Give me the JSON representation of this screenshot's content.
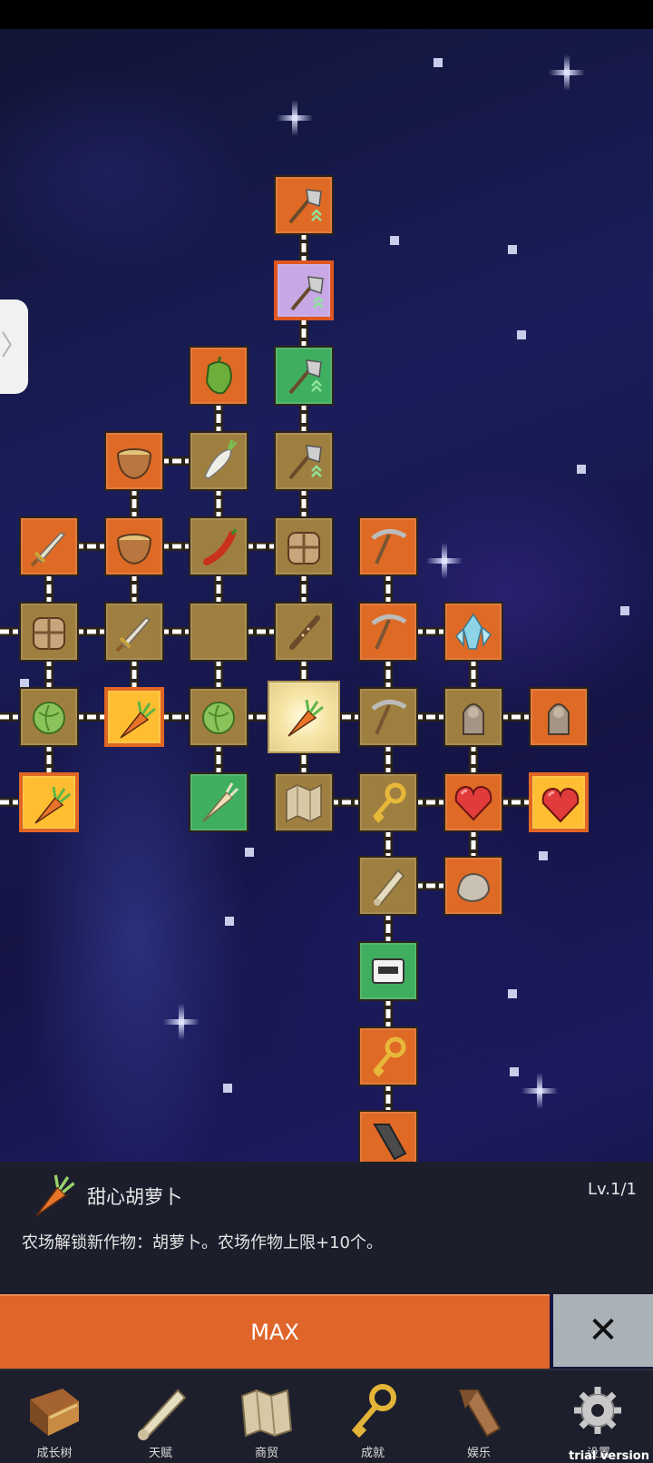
{
  "side_handle": {
    "glyph": "〉"
  },
  "info": {
    "icon": "carrot-icon",
    "name": "甜心胡萝卜",
    "level": "Lv.1/1",
    "description": "农场解锁新作物：胡萝卜。农场作物上限+10个。"
  },
  "actions": {
    "max_label": "MAX",
    "close_label": "✕"
  },
  "nav": [
    {
      "label": "成长树",
      "icon": "book-icon"
    },
    {
      "label": "天赋",
      "icon": "scroll-icon"
    },
    {
      "label": "商贸",
      "icon": "map-icon"
    },
    {
      "label": "成就",
      "icon": "key-icon"
    },
    {
      "label": "娱乐",
      "icon": "horn-icon"
    },
    {
      "label": "设置",
      "icon": "gear-icon"
    }
  ],
  "watermark": "trial version",
  "tree_nodes": [
    {
      "id": "n1",
      "icon": "shovel-upgrade-icon",
      "color": "orange"
    },
    {
      "id": "n2",
      "icon": "shovel-upgrade-icon",
      "color": "purple"
    },
    {
      "id": "n3",
      "icon": "pepper-icon",
      "color": "orange"
    },
    {
      "id": "n4",
      "icon": "shovel-upgrade-icon",
      "color": "green"
    },
    {
      "id": "n5",
      "icon": "bowl-icon",
      "color": "orange"
    },
    {
      "id": "n6",
      "icon": "radish-icon",
      "color": "brown"
    },
    {
      "id": "n7",
      "icon": "shovel-upgrade-icon",
      "color": "brown"
    },
    {
      "id": "n8",
      "icon": "sword-icon",
      "color": "orange"
    },
    {
      "id": "n9",
      "icon": "bowl-icon",
      "color": "orange"
    },
    {
      "id": "n10",
      "icon": "chili-icon",
      "color": "brown"
    },
    {
      "id": "n11",
      "icon": "backpack-icon",
      "color": "brown"
    },
    {
      "id": "n12",
      "icon": "pickaxe-icon",
      "color": "orange"
    },
    {
      "id": "n13",
      "icon": "backpack-icon",
      "color": "brown"
    },
    {
      "id": "n14",
      "icon": "sword-icon",
      "color": "brown"
    },
    {
      "id": "n15",
      "icon": "corn-icon",
      "color": "brown"
    },
    {
      "id": "n16",
      "icon": "flute-icon",
      "color": "brown"
    },
    {
      "id": "n17",
      "icon": "pickaxe-icon",
      "color": "orange"
    },
    {
      "id": "n18",
      "icon": "crystal-icon",
      "color": "orange"
    },
    {
      "id": "n19",
      "icon": "cabbage-icon",
      "color": "brown"
    },
    {
      "id": "n20",
      "icon": "carrot-icon",
      "color": "goldbox"
    },
    {
      "id": "n21",
      "icon": "cabbage-icon",
      "color": "brown"
    },
    {
      "id": "n22",
      "icon": "carrot-icon",
      "color": "center"
    },
    {
      "id": "n23",
      "icon": "pickaxe-icon",
      "color": "brown"
    },
    {
      "id": "n24",
      "icon": "statue-icon",
      "color": "brown"
    },
    {
      "id": "n25",
      "icon": "statue-icon",
      "color": "orange"
    },
    {
      "id": "n26",
      "icon": "carrot-icon",
      "color": "goldbox"
    },
    {
      "id": "n27",
      "icon": "parsnip-icon",
      "color": "green"
    },
    {
      "id": "n28",
      "icon": "map-icon",
      "color": "brown"
    },
    {
      "id": "n29",
      "icon": "key-icon",
      "color": "brown"
    },
    {
      "id": "n30",
      "icon": "heart-icon",
      "color": "orange"
    },
    {
      "id": "n31",
      "icon": "heart-icon",
      "color": "goldbox"
    },
    {
      "id": "n32",
      "icon": "scroll-icon",
      "color": "brown"
    },
    {
      "id": "n33",
      "icon": "stone-icon",
      "color": "orange"
    },
    {
      "id": "n34",
      "icon": "cassette-icon",
      "color": "green"
    },
    {
      "id": "n35",
      "icon": "key-icon",
      "color": "orange"
    },
    {
      "id": "n36",
      "icon": "horn-icon",
      "color": "orange"
    }
  ]
}
